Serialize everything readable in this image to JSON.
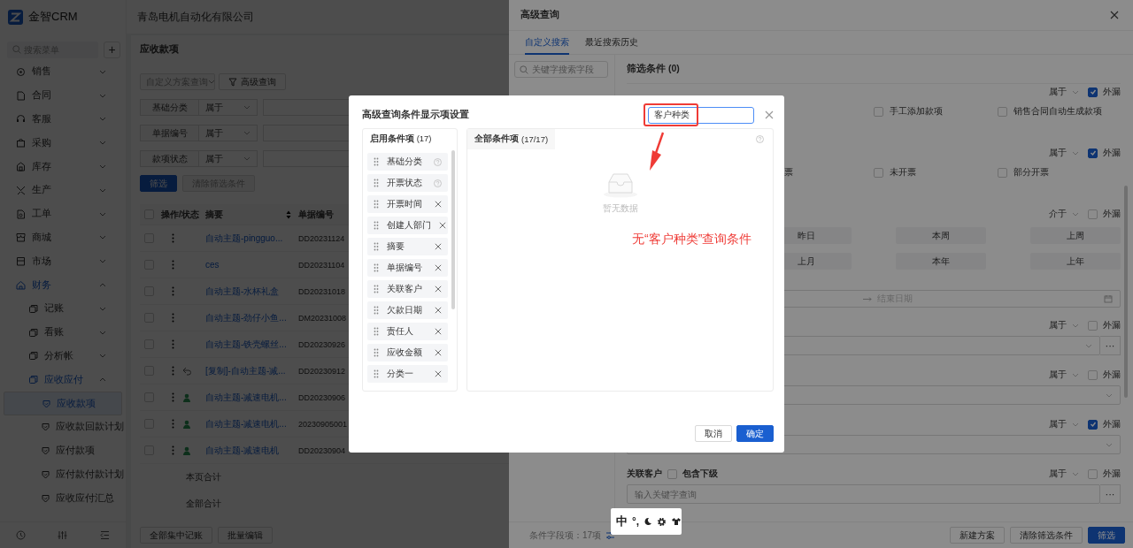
{
  "app": {
    "logo_text": "金智CRM",
    "company": "青岛电机自动化有限公司"
  },
  "sidebar": {
    "search_placeholder": "搜索菜单",
    "add_button": "+",
    "items": [
      {
        "label": "销售",
        "expanded": false,
        "selected": false
      },
      {
        "label": "合同",
        "expanded": false,
        "selected": false
      },
      {
        "label": "客服",
        "expanded": false,
        "selected": false
      },
      {
        "label": "采购",
        "expanded": false,
        "selected": false
      },
      {
        "label": "库存",
        "expanded": false,
        "selected": false
      },
      {
        "label": "生产",
        "expanded": false,
        "selected": false
      },
      {
        "label": "工单",
        "expanded": false,
        "selected": false
      },
      {
        "label": "商城",
        "expanded": false,
        "selected": false
      },
      {
        "label": "市场",
        "expanded": false,
        "selected": false
      },
      {
        "label": "财务",
        "expanded": true,
        "selected": false,
        "children": [
          {
            "label": "记账",
            "expanded": false,
            "selected": false
          },
          {
            "label": "看账",
            "expanded": false,
            "selected": false
          },
          {
            "label": "分析帐",
            "expanded": false,
            "selected": false
          },
          {
            "label": "应收应付",
            "expanded": true,
            "selected": false,
            "children": [
              {
                "label": "应收款项",
                "selected": true
              },
              {
                "label": "应收款回款计划",
                "selected": false
              },
              {
                "label": "应付款项",
                "selected": false
              },
              {
                "label": "应付款付款计划",
                "selected": false
              },
              {
                "label": "应收应付汇总",
                "selected": false
              }
            ]
          }
        ]
      }
    ]
  },
  "page": {
    "title": "应收款项",
    "scheme_placeholder": "自定义方案查询",
    "advanced_button": "高级查询",
    "filters": [
      {
        "field": "基础分类",
        "operator": "属于"
      },
      {
        "field": "单据编号",
        "operator": "属于"
      },
      {
        "field": "款项状态",
        "operator": "属于"
      }
    ],
    "filter_button": "筛选",
    "clear_button": {
      "label": "清除筛选条件",
      "disabled": true
    },
    "table": {
      "select_all_checked": false,
      "columns": [
        "操作/状态",
        "摘要",
        "单据编号"
      ],
      "rows": [
        {
          "checked": false,
          "kind": "plain",
          "summary": "自动主题-pingguo...",
          "number": "DD20231124"
        },
        {
          "checked": false,
          "kind": "plain",
          "summary": "ces",
          "number": "DD20231104"
        },
        {
          "checked": false,
          "kind": "plain",
          "summary": "自动主题-水杯礼盒",
          "number": "DD20231018"
        },
        {
          "checked": false,
          "kind": "plain",
          "summary": "自动主题-劲仔小鱼...",
          "number": "DM20231008"
        },
        {
          "checked": false,
          "kind": "plain",
          "summary": "自动主题-铁壳螺丝...",
          "number": "DD20230926"
        },
        {
          "checked": false,
          "kind": "reverted",
          "summary": "[复制]-自动主题-减...",
          "number": "DD20230912"
        },
        {
          "checked": false,
          "kind": "assigned",
          "summary": "自动主题-减速电机...",
          "number": "DD20230906"
        },
        {
          "checked": false,
          "kind": "assigned",
          "summary": "自动主题-减速电机...",
          "number": "20230905001"
        },
        {
          "checked": false,
          "kind": "assigned",
          "summary": "自动主题-减速电机",
          "number": "DD20230904"
        }
      ],
      "totals": [
        "本页合计",
        "全部合计"
      ]
    },
    "bottom_buttons": [
      "全部集中记账",
      "批量编辑"
    ]
  },
  "drawer": {
    "title": "高级查询",
    "tabs": [
      {
        "label": "自定义搜索",
        "selected": true
      },
      {
        "label": "最近搜索历史",
        "selected": false
      }
    ],
    "field_search_placeholder": "关键字搜索字段",
    "conditions_title": "筛选条件 (0)",
    "conditions": [
      {
        "kind": "options",
        "operator": "属于",
        "leak_label": "外漏",
        "leak_checked": true,
        "options": [
          {
            "label": "手工添加款项",
            "checked": false
          },
          {
            "label": "销售合同自动生成款项",
            "checked": false
          }
        ]
      },
      {
        "kind": "options",
        "operator": "属于",
        "leak_label": "外漏",
        "leak_checked": true,
        "clipped_text": "票",
        "options": [
          {
            "label": "未开票",
            "checked": false
          },
          {
            "label": "部分开票",
            "checked": false
          }
        ]
      },
      {
        "kind": "quick_dates",
        "operator": "介于",
        "leak_label": "外漏",
        "leak_checked": false,
        "buttons": [
          [
            "昨日",
            "本周",
            "上周"
          ],
          [
            "上月",
            "本年",
            "上年"
          ]
        ],
        "end_placeholder": "结束日期"
      },
      {
        "kind": "select",
        "operator": "属于",
        "leak_label": "外漏",
        "leak_checked": false,
        "more": "···"
      },
      {
        "kind": "select",
        "operator": "属于",
        "leak_label": "外漏",
        "leak_checked": false
      },
      {
        "kind": "select",
        "operator": "属于",
        "leak_label": "外漏",
        "leak_checked": true
      },
      {
        "kind": "customer",
        "label": "关联客户",
        "include_label": "包含下级",
        "include_checked": false,
        "operator": "属于",
        "leak_label": "外漏",
        "leak_checked": false,
        "placeholder": "输入关键字查询",
        "more": "···"
      }
    ],
    "footer": {
      "count": "条件字段项：17项",
      "buttons": [
        {
          "label": "新建方案",
          "kind": "default"
        },
        {
          "label": "清除筛选条件",
          "kind": "default"
        },
        {
          "label": "筛选",
          "kind": "primary"
        }
      ]
    }
  },
  "modal": {
    "title": "高级查询条件显示项设置",
    "search_value": "客户种类",
    "enabled": {
      "title": "启用条件项",
      "count": "(17)",
      "items": [
        {
          "label": "基础分类",
          "removable": false
        },
        {
          "label": "开票状态",
          "removable": false
        },
        {
          "label": "开票时间",
          "removable": true
        },
        {
          "label": "创建人部门",
          "removable": true
        },
        {
          "label": "摘要",
          "removable": true
        },
        {
          "label": "单据编号",
          "removable": true
        },
        {
          "label": "关联客户",
          "removable": true
        },
        {
          "label": "欠款日期",
          "removable": true
        },
        {
          "label": "责任人",
          "removable": true
        },
        {
          "label": "应收金额",
          "removable": true
        },
        {
          "label": "分类一",
          "removable": true
        }
      ]
    },
    "all": {
      "title": "全部条件项",
      "count": "(17/17)",
      "empty_text": "暂无数据"
    },
    "cancel": "取消",
    "ok": "确定"
  },
  "annotation": {
    "note": "无“客户种类”查询条件"
  },
  "ime_toolbar": {
    "mode": "中",
    "punctuation": "°,"
  }
}
